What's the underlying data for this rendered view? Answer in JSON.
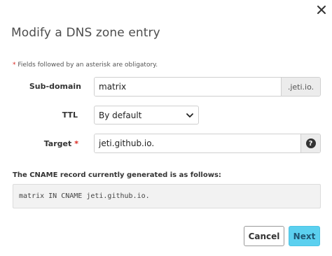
{
  "dialog": {
    "title": "Modify a DNS zone entry",
    "close_icon": "close-icon"
  },
  "form": {
    "required_star": "*",
    "required_note": "Fields followed by an asterisk are obligatory.",
    "subdomain": {
      "label": "Sub-domain",
      "value": "matrix",
      "suffix": ".jeti.io."
    },
    "ttl": {
      "label": "TTL",
      "selected": "By default"
    },
    "target": {
      "label": "Target",
      "star": "*",
      "value": "jeti.github.io.",
      "help_glyph": "?"
    }
  },
  "cname": {
    "label": "The CNAME record currently generated is as follows:",
    "record": "matrix IN CNAME jeti.github.io."
  },
  "buttons": {
    "cancel": "Cancel",
    "next": "Next"
  },
  "colors": {
    "primary": "#5bd0ef",
    "required": "#d9251d"
  }
}
